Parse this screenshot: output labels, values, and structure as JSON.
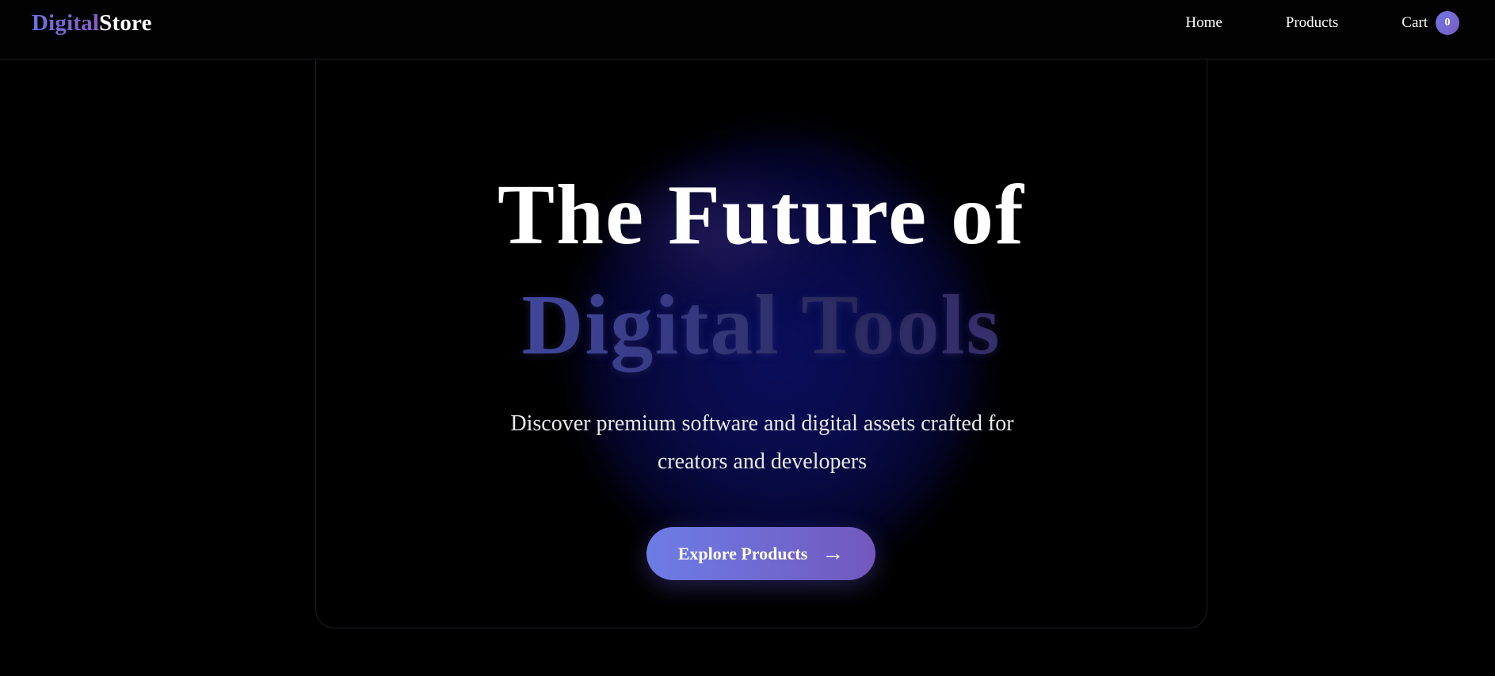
{
  "header": {
    "logo_part1": "Digital",
    "logo_part2": "Store",
    "nav": {
      "home": "Home",
      "products": "Products",
      "cart": "Cart",
      "cart_count": "0"
    }
  },
  "hero": {
    "title_line1": "The Future of",
    "title_line2": "Digital Tools",
    "subtitle": "Discover premium software and digital assets crafted for creators and developers",
    "cta_label": "Explore Products",
    "cta_icon": "→"
  },
  "colors": {
    "background": "#000000",
    "accent_start": "#6d7ce6",
    "accent_end": "#7258bd",
    "glow": "#0b0e5c"
  },
  "icons": {
    "cta": "arrow-right-icon"
  }
}
